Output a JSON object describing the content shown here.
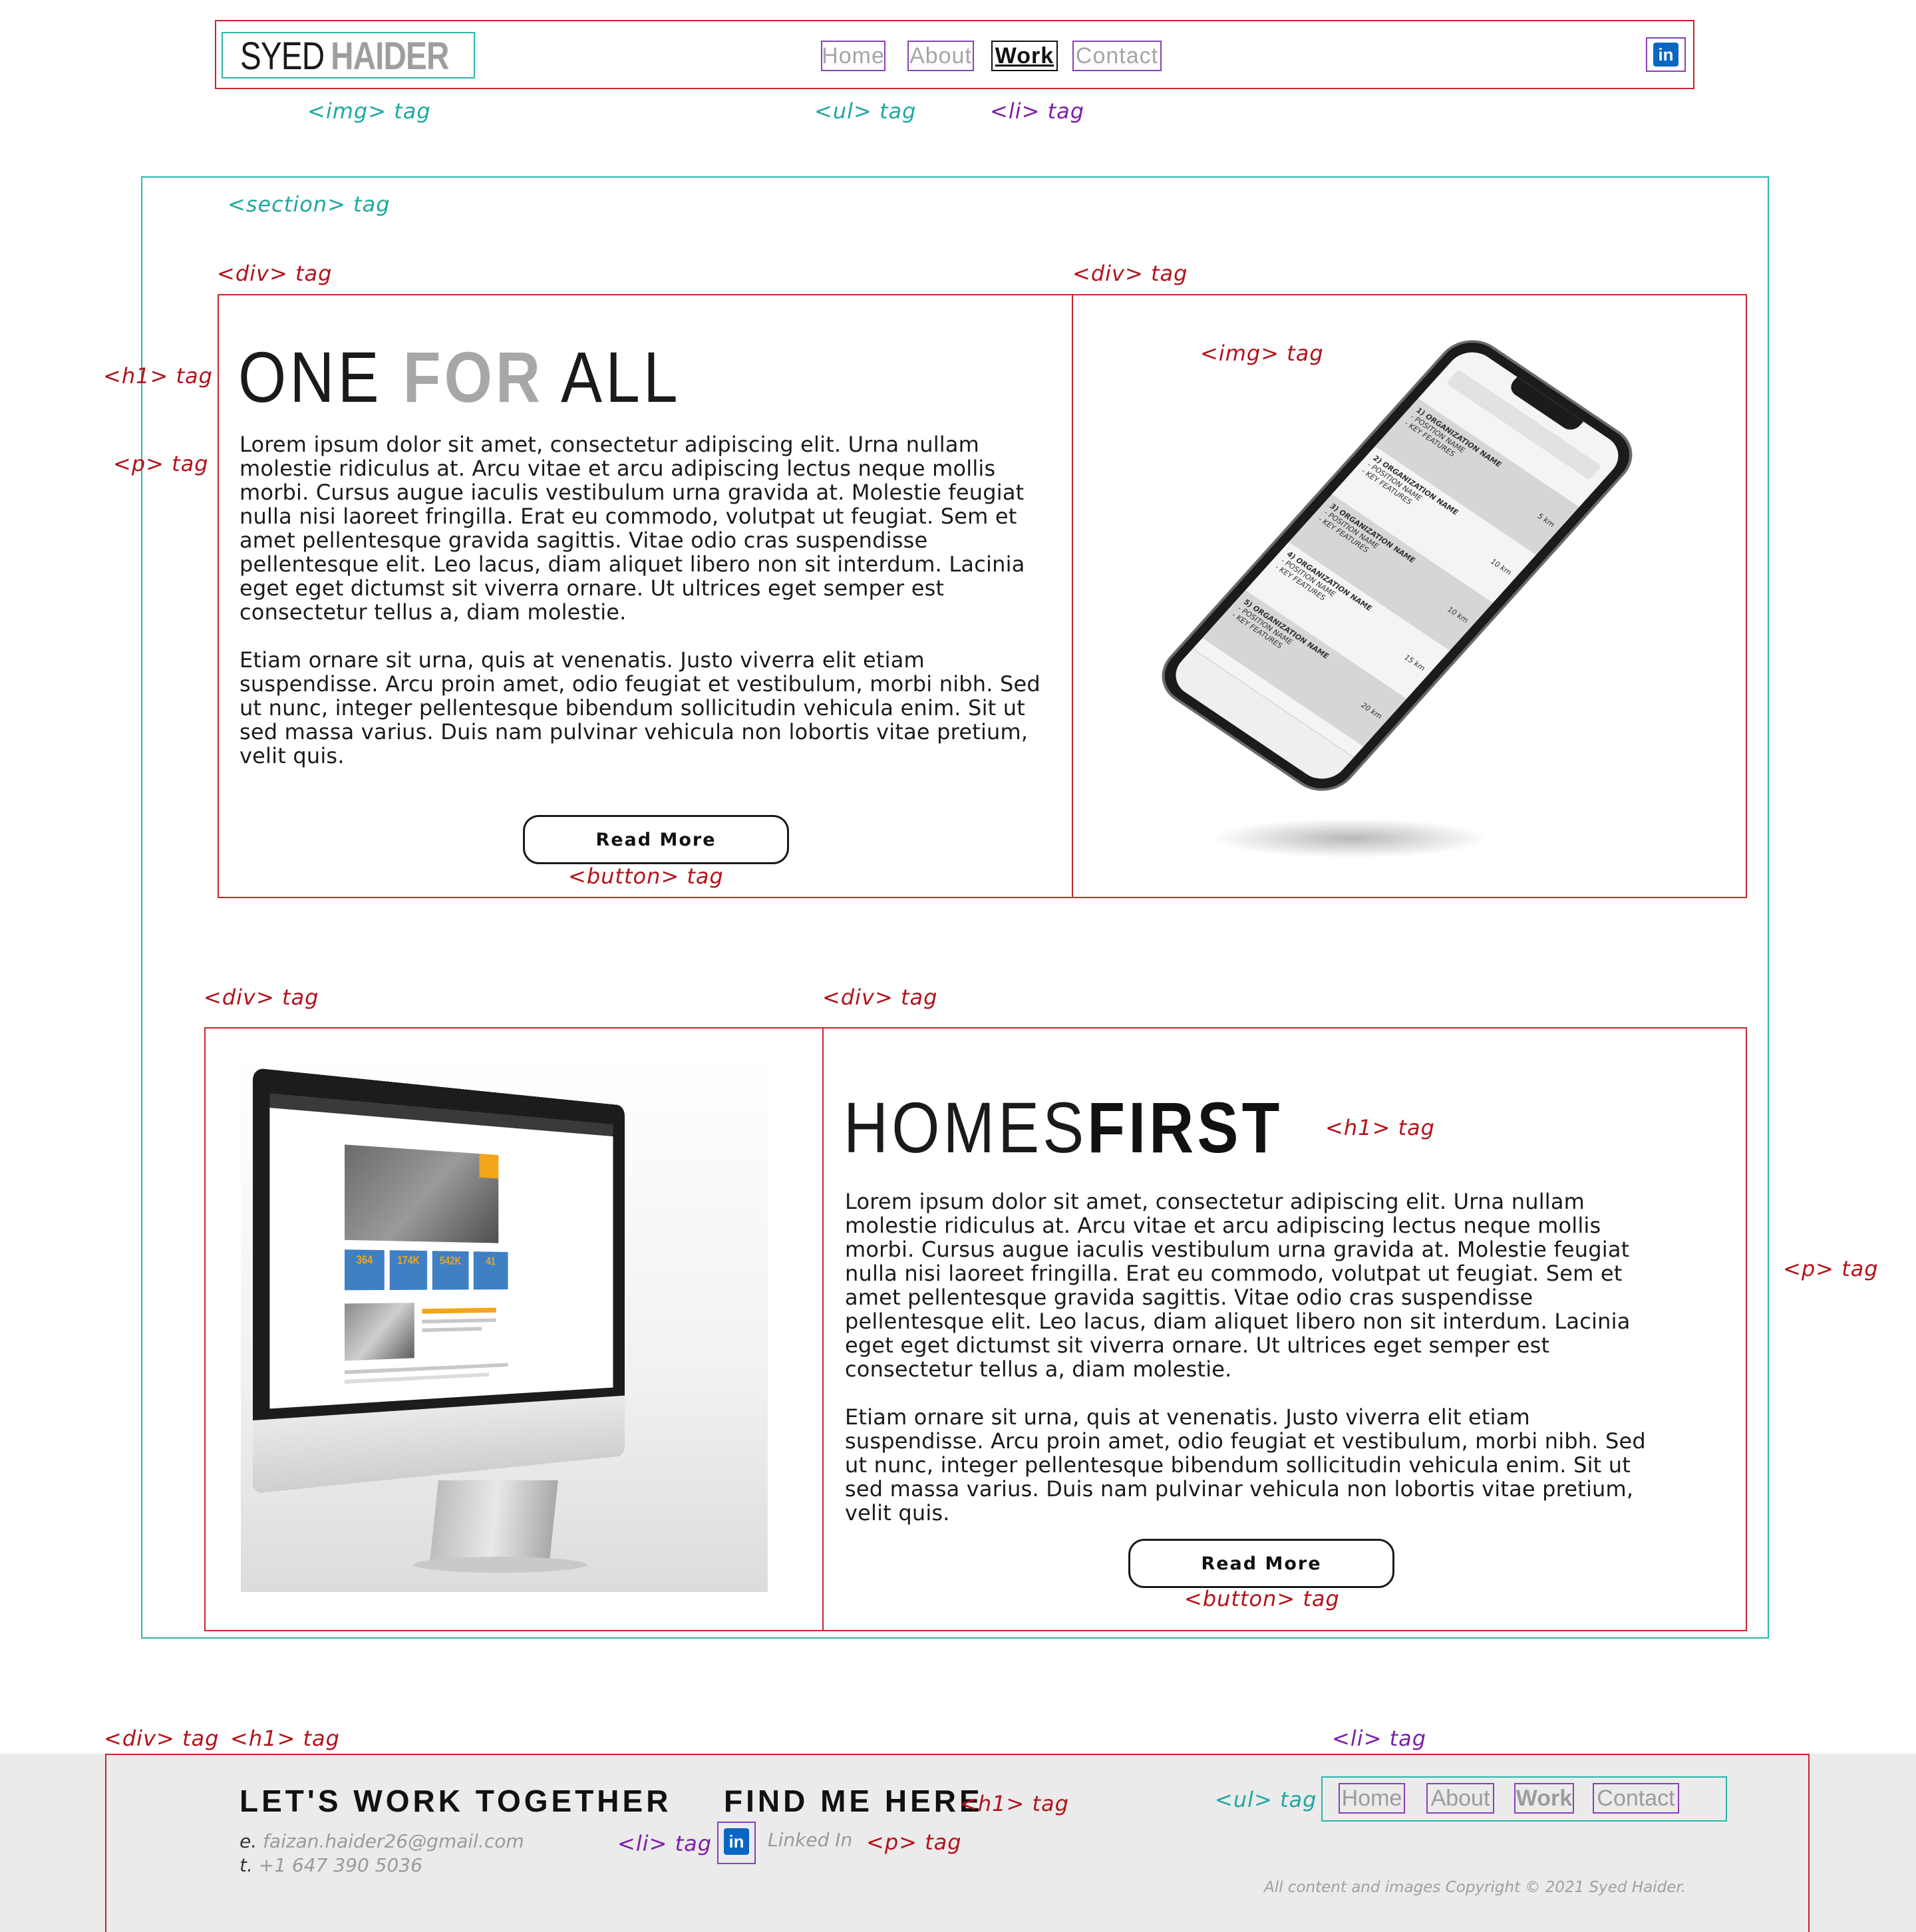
{
  "header": {
    "logo_first": "SYED",
    "logo_second": "HAIDER",
    "nav": [
      "Home",
      "About",
      "Work",
      "Contact"
    ],
    "linkedin_icon": "in"
  },
  "tags": {
    "img": "<img> tag",
    "ul": "<ul> tag",
    "li": "<li> tag",
    "section": "<section> tag",
    "div": "<div> tag",
    "h1": "<h1> tag",
    "p": "<p> tag",
    "button": "<button> tag"
  },
  "project1": {
    "title_a": "ONE",
    "title_b": "FOR",
    "title_c": "ALL",
    "para1": "Lorem ipsum dolor sit amet, consectetur adipiscing elit. Urna nullam molestie ridiculus at. Arcu vitae et arcu adipiscing lectus neque mollis morbi. Cursus augue iaculis vestibulum urna gravida at. Molestie feugiat nulla nisi laoreet fringilla. Erat eu commodo, volutpat ut feugiat. Sem et amet pellentesque gravida sagittis. Vitae odio cras suspendisse pellentesque elit. Leo lacus, diam aliquet libero non sit interdum. Lacinia eget eget dictumst sit viverra ornare. Ut ultrices eget semper est consectetur tellus a, diam molestie.",
    "para2": "Etiam ornare sit urna, quis at venenatis. Justo viverra elit etiam suspendisse. Arcu proin amet, odio feugiat et vestibulum, morbi nibh. Sed ut nunc, integer pellentesque bibendum sollicitudin vehicula enim. Sit ut sed massa varius. Duis nam pulvinar vehicula non lobortis vitae pretium, velit quis.",
    "button": "Read More",
    "phone_items": [
      {
        "name": "1) ORGANIZATION NAME",
        "sub1": "- POSITION NAME",
        "sub2": "- KEY FEATURES",
        "dist": "5 km"
      },
      {
        "name": "2) ORGANIZATION NAME",
        "sub1": "- POSITION NAME",
        "sub2": "- KEY FEATURES",
        "dist": "10 km"
      },
      {
        "name": "3) ORGANIZATION NAME",
        "sub1": "- POSITION NAME",
        "sub2": "- KEY FEATURES",
        "dist": "10 km"
      },
      {
        "name": "4) ORGANIZATION NAME",
        "sub1": "- POSITION NAME",
        "sub2": "- KEY FEATURES",
        "dist": "15 km"
      },
      {
        "name": "5) ORGANIZATION NAME",
        "sub1": "- POSITION NAME",
        "sub2": "- KEY FEATURES",
        "dist": "20 km"
      }
    ]
  },
  "project2": {
    "title_a": "HOMES",
    "title_b": "FIRST",
    "para1": "Lorem ipsum dolor sit amet, consectetur adipiscing elit. Urna nullam molestie ridiculus at. Arcu vitae et arcu adipiscing lectus neque mollis morbi. Cursus augue iaculis vestibulum urna gravida at. Molestie feugiat nulla nisi laoreet fringilla. Erat eu commodo, volutpat ut feugiat. Sem et amet pellentesque gravida sagittis. Vitae odio cras suspendisse pellentesque elit. Leo lacus, diam aliquet libero non sit interdum. Lacinia eget eget dictumst sit viverra ornare. Ut ultrices eget semper est consectetur tellus a, diam molestie.",
    "para2": "Etiam ornare sit urna, quis at venenatis. Justo viverra elit etiam suspendisse. Arcu proin amet, odio feugiat et vestibulum, morbi nibh. Sed ut nunc, integer pellentesque bibendum sollicitudin vehicula enim. Sit ut sed massa varius. Duis nam pulvinar vehicula non lobortis vitae pretium, velit quis.",
    "button": "Read More",
    "screen_stats": [
      "364",
      "174K",
      "542K",
      "41"
    ]
  },
  "footer": {
    "heading1": "LET'S WORK TOGETHER",
    "heading2": "FIND ME HERE",
    "email_key": "e.",
    "email": "faizan.haider26@gmail.com",
    "phone_key": "t.",
    "phone": "+1 647 390 5036",
    "linkedin_label": "Linked In",
    "nav": [
      "Home",
      "About",
      "Work",
      "Contact"
    ],
    "copyright": "All content and images Copyright © 2021 Syed Haider."
  },
  "colors": {
    "red_outline": "#c4262e",
    "teal_outline": "#2bb5ad",
    "purple_outline": "#8a3fb8",
    "linkedin": "#0a66c2",
    "footer_bg": "#ebebeb"
  }
}
